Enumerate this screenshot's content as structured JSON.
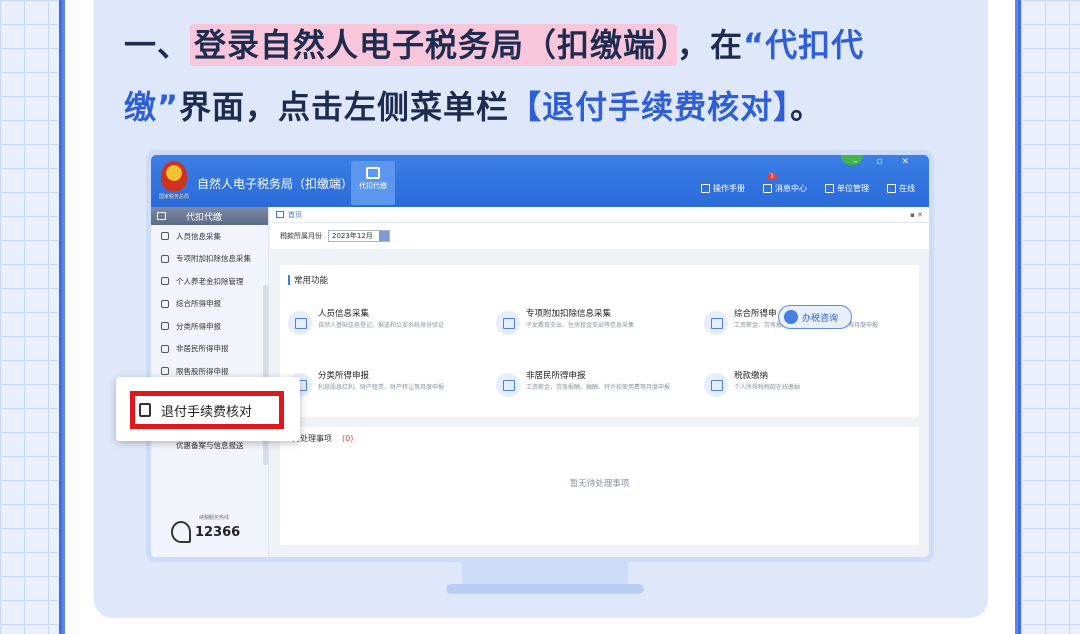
{
  "headline": {
    "line1_prefix": "一、",
    "line1_highlight": "登录自然人电子税务局（扣缴端）",
    "line1_suffix": "，在",
    "quote_start": "“代扣代",
    "line2_quote_end": "缴”",
    "line2_mid": "界面，点击左侧菜单栏",
    "line2_bracket": "【退付手续费核对】",
    "line2_end": "。"
  },
  "app": {
    "title": "自然人电子税务局（扣缴端）",
    "emblem_caption": "国家税务总局",
    "active_tab": "代扣代缴",
    "avatar": "71",
    "window_controls": "– ▫ ✕",
    "notification_count": "1",
    "toolbar": [
      "操作手册",
      "消息中心",
      "单位管理",
      "在线"
    ]
  },
  "sidebar": {
    "header": "代扣代缴",
    "items": [
      "人员信息采集",
      "专项附加扣除信息采集",
      "个人养老金扣除管理",
      "综合所得申报",
      "分类所得申报",
      "非居民所得申报",
      "限售股所得申报"
    ],
    "collapse_label": "«",
    "hotline_caption": "纳税服务热线",
    "hotline_number": "12366"
  },
  "main": {
    "breadcrumb": "首页",
    "window_btns": "▪ ✕",
    "period_label": "税款所属月份",
    "period_value": "2023年12月",
    "panel_title": "常用功能",
    "functions": [
      {
        "title": "人员信息采集",
        "desc": "自然人基础信息登记、报送和公安系统身份验证"
      },
      {
        "title": "专项附加扣除信息采集",
        "desc": "子女教育支出、住房租金支出等信息采集"
      },
      {
        "title": "综合所得申",
        "desc": "工资薪金、劳务报酬、稿酬、特许权使用费等月度申报"
      },
      {
        "title": "分类所得申报",
        "desc": "利息股息红利、财产租赁、财产转让等月度申报"
      },
      {
        "title": "非居民所得申报",
        "desc": "工资薪金、劳务报酬、稿酬、特许权使用费等月度申报"
      },
      {
        "title": "税款缴纳",
        "desc": "个人所得税税款在线缴纳"
      }
    ],
    "consult_label": "办税咨询",
    "pending_title": "待处理事项",
    "pending_count": "(0)",
    "pending_empty": "暂无待处理事项"
  },
  "callout": {
    "label": "退付手续费核对",
    "behind_item": "优惠备案与信息报送"
  },
  "colors": {
    "page_bg": "#5b84e3",
    "card_bg": "#dfe8fb",
    "highlight": "#f7c6db",
    "accent_blue": "#2f5fd8",
    "callout_border": "#e0161b"
  }
}
